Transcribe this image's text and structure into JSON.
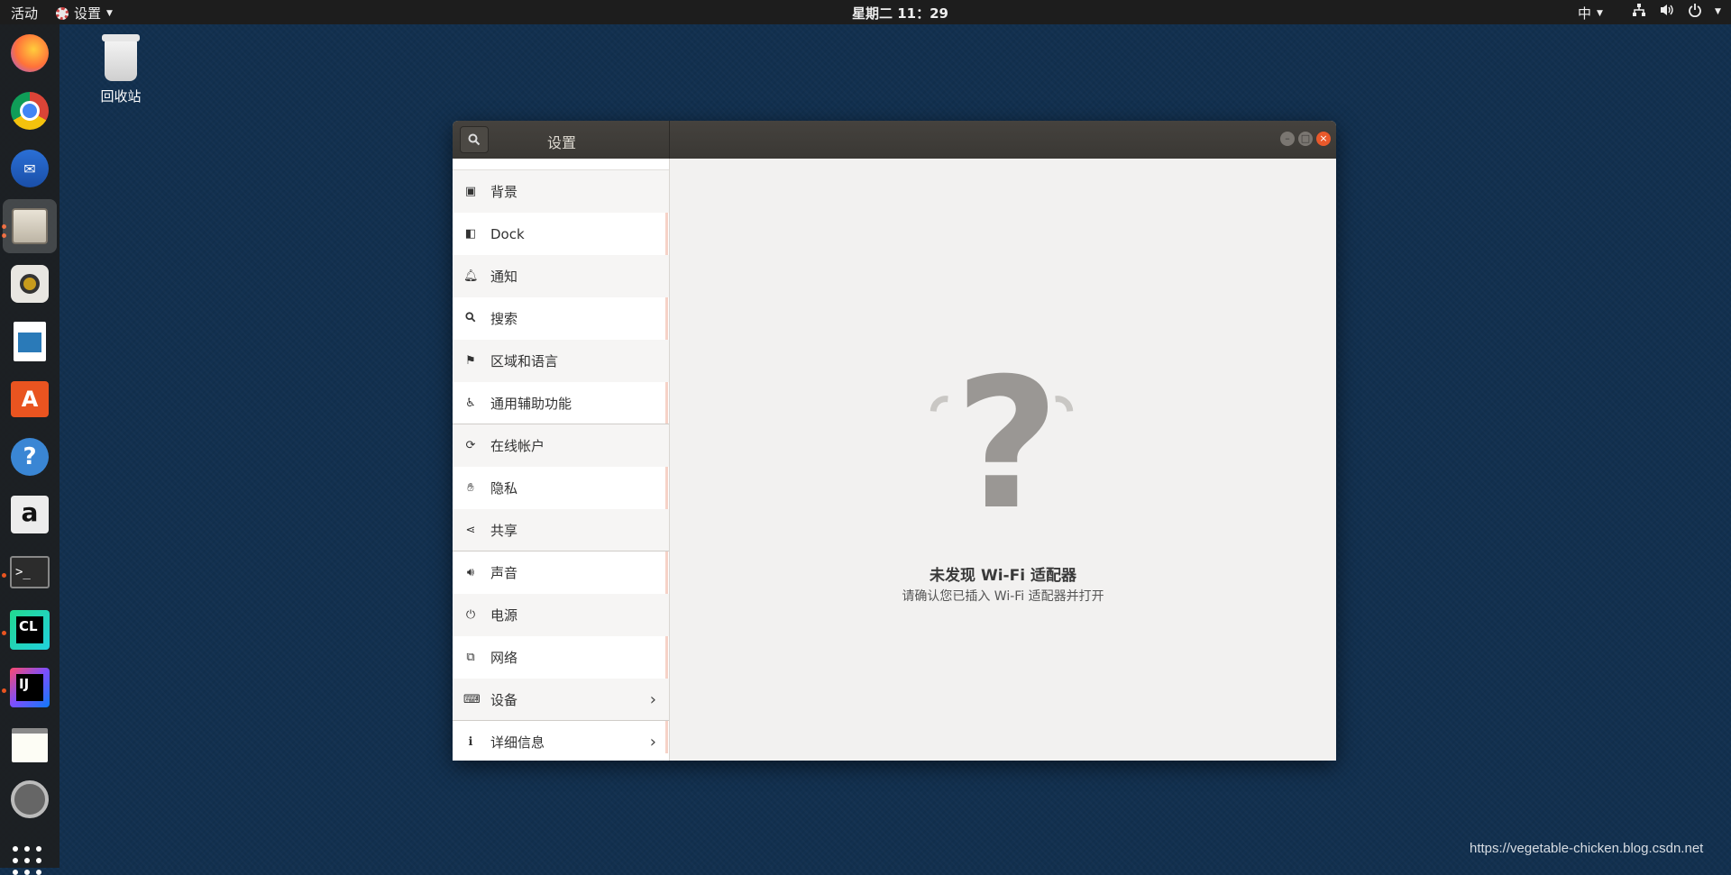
{
  "topbar": {
    "activities": "活动",
    "app_menu": "设置",
    "clock": "星期二 11：29",
    "input_method": "中"
  },
  "desktop": {
    "trash_label": "回收站"
  },
  "window": {
    "title": "设置",
    "sidebar": [
      {
        "label": "背景",
        "icon": "background-icon"
      },
      {
        "label": "Dock",
        "icon": "dock-icon"
      },
      {
        "label": "通知",
        "icon": "bell-icon"
      },
      {
        "label": "搜索",
        "icon": "search-icon"
      },
      {
        "label": "区域和语言",
        "icon": "region-icon"
      },
      {
        "label": "通用辅助功能",
        "icon": "accessibility-icon"
      },
      {
        "label": "在线帐户",
        "icon": "online-accounts-icon"
      },
      {
        "label": "隐私",
        "icon": "privacy-hand-icon"
      },
      {
        "label": "共享",
        "icon": "share-icon"
      },
      {
        "label": "声音",
        "icon": "speaker-icon"
      },
      {
        "label": "电源",
        "icon": "power-plug-icon"
      },
      {
        "label": "网络",
        "icon": "network-icon"
      },
      {
        "label": "设备",
        "icon": "devices-icon"
      },
      {
        "label": "详细信息",
        "icon": "info-icon"
      }
    ],
    "empty_state": {
      "title": "未发现 Wi-Fi 适配器",
      "subtitle": "请确认您已插入 Wi-Fi 适配器并打开"
    }
  },
  "watermark": "https://vegetable-chicken.blog.csdn.net",
  "colors": {
    "accent": "#e95420",
    "desktop": "#12304f",
    "titlebar": "#3c3b37"
  }
}
